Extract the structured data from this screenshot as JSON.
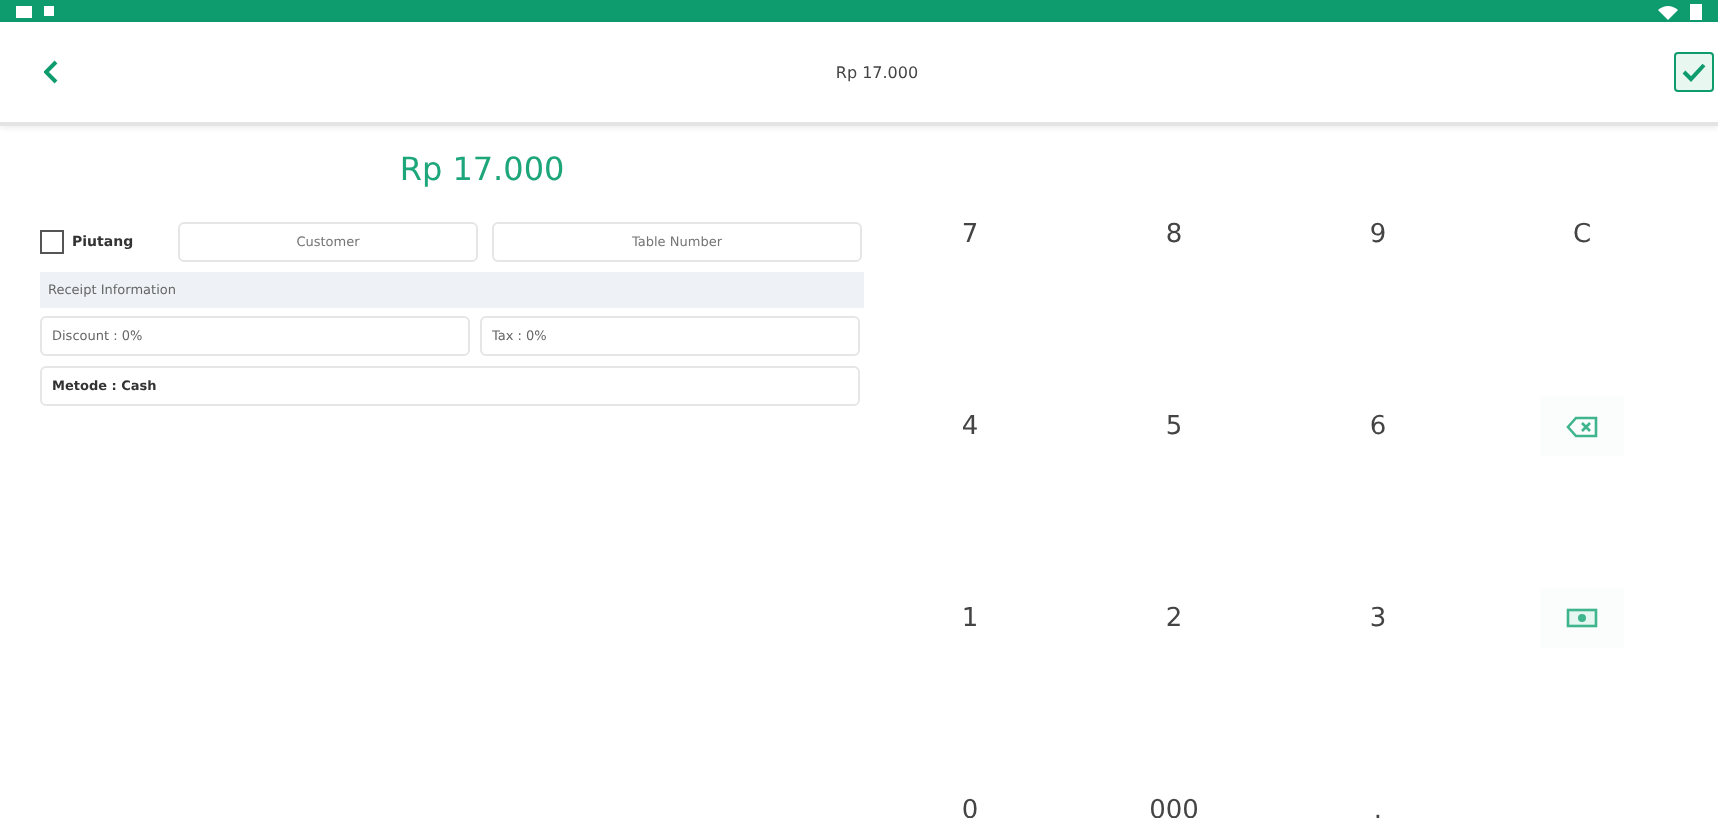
{
  "header": {
    "title": "Rp 17.000"
  },
  "total": "Rp 17.000",
  "form": {
    "piutang": {
      "label": "Piutang",
      "checked": false
    },
    "customer": {
      "placeholder": "Customer"
    },
    "table_number": {
      "placeholder": "Table Number"
    },
    "section_title": "Receipt Information",
    "discount": {
      "value": "Discount : 0%"
    },
    "tax": {
      "value": "Tax : 0%"
    },
    "method": {
      "value": "Metode : Cash"
    }
  },
  "keypad": [
    {
      "kind": "text",
      "label": "7"
    },
    {
      "kind": "text",
      "label": "8"
    },
    {
      "kind": "text",
      "label": "9"
    },
    {
      "kind": "text",
      "label": "C"
    },
    {
      "kind": "text",
      "label": "4"
    },
    {
      "kind": "text",
      "label": "5"
    },
    {
      "kind": "text",
      "label": "6"
    },
    {
      "kind": "backspace"
    },
    {
      "kind": "text",
      "label": "1"
    },
    {
      "kind": "text",
      "label": "2"
    },
    {
      "kind": "text",
      "label": "3"
    },
    {
      "kind": "cash"
    },
    {
      "kind": "text",
      "label": "0"
    },
    {
      "kind": "text",
      "label": "000"
    },
    {
      "kind": "text",
      "label": "."
    },
    {
      "kind": "empty"
    }
  ]
}
